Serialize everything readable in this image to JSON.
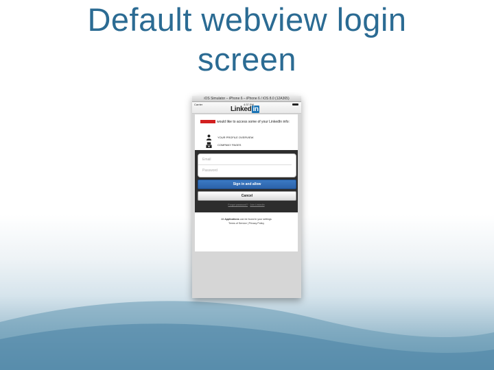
{
  "slide": {
    "title_line1": "Default webview login",
    "title_line2": "screen"
  },
  "simulator": {
    "window_title": "iOS Simulator – iPhone 6 – iPhone 6 / iOS 8.0 (12A365)",
    "status": {
      "carrier": "Carrier",
      "time": "4:37 PM"
    },
    "logo_text": "Linked",
    "logo_badge": "in"
  },
  "dialog": {
    "access_text": "would like to access some of your LinkedIn info:",
    "permissions": [
      {
        "label": "YOUR PROFILE OVERVIEW",
        "icon": "person-icon"
      },
      {
        "label": "COMPANY PAGES",
        "icon": "building-icon"
      }
    ],
    "email_placeholder": "Email",
    "password_placeholder": "Password",
    "sign_in_label": "Sign in and allow",
    "cancel_label": "Cancel",
    "forgot_password": "Forgot password?",
    "join_linkedin": "Join LinkedIn",
    "link_separator": "·",
    "footer_all": "All ",
    "footer_applications": "Applications",
    "footer_rest": " can be found in your settings",
    "terms": "Terms of Service",
    "privacy": "Privacy Policy",
    "terms_sep": " | "
  },
  "colors": {
    "title": "#2b6b93",
    "linkedin_blue": "#1c75b6",
    "sign_in_button": "#2c62a9",
    "redaction": "#d21f1f"
  }
}
